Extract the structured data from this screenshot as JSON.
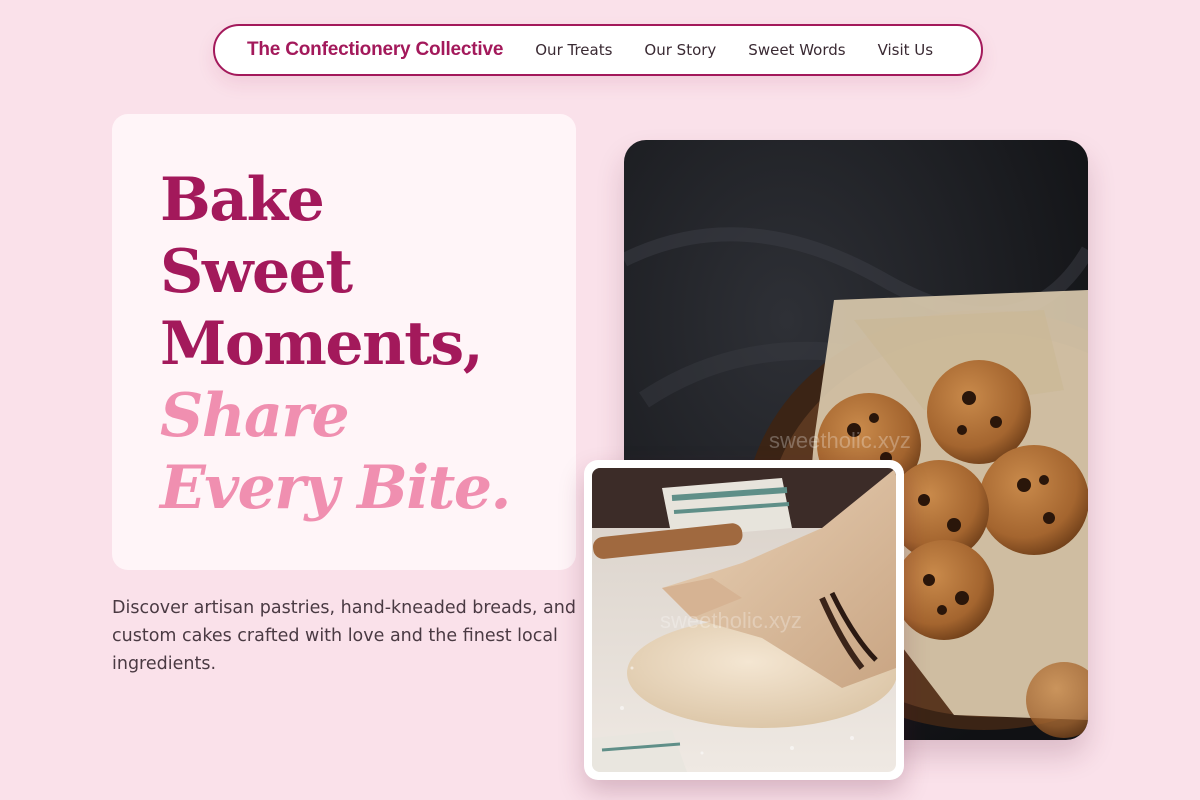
{
  "nav": {
    "brand": "The Confectionery Collective",
    "links": [
      {
        "label": "Our Treats"
      },
      {
        "label": "Our Story"
      },
      {
        "label": "Sweet Words"
      },
      {
        "label": "Visit Us"
      }
    ]
  },
  "hero": {
    "headline_lines": [
      "Bake",
      "Sweet",
      "Moments,"
    ],
    "accent_lines": [
      "Share",
      "Every Bite."
    ],
    "description": "Discover artisan pastries, hand-kneaded breads, and custom cakes crafted with love and the finest local ingredients."
  },
  "images": {
    "cookies_watermark": "sweetholic.xyz",
    "dough_watermark": "sweetholic.xyz"
  },
  "colors": {
    "background": "#fae1ea",
    "brand": "#a3195b",
    "accent": "#f08fb0",
    "card": "#fff5f8"
  }
}
